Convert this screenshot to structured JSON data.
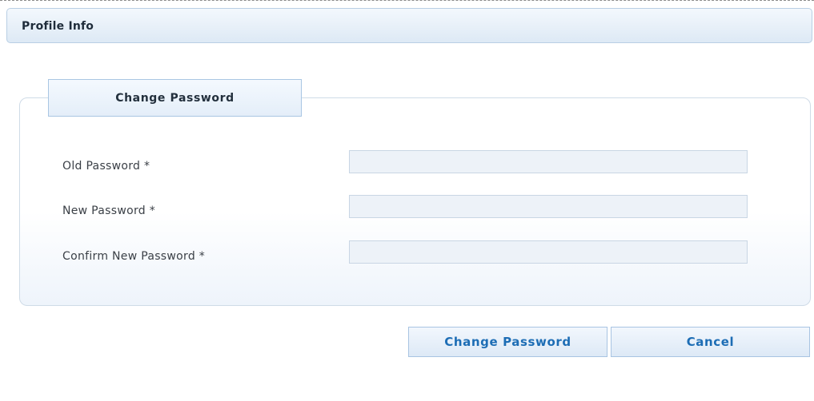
{
  "header": {
    "title": "Profile Info"
  },
  "form": {
    "legend": "Change Password",
    "fields": [
      {
        "label": "Old Password *",
        "value": "",
        "placeholder": ""
      },
      {
        "label": "New Password *",
        "value": "",
        "placeholder": ""
      },
      {
        "label": "Confirm New Password *",
        "value": "",
        "placeholder": ""
      }
    ]
  },
  "actions": {
    "change_label": "Change Password",
    "cancel_label": "Cancel"
  },
  "colors": {
    "button_text": "#1d6db5",
    "input_background": "#edf2f8",
    "panel_border": "#cfdbe7"
  }
}
